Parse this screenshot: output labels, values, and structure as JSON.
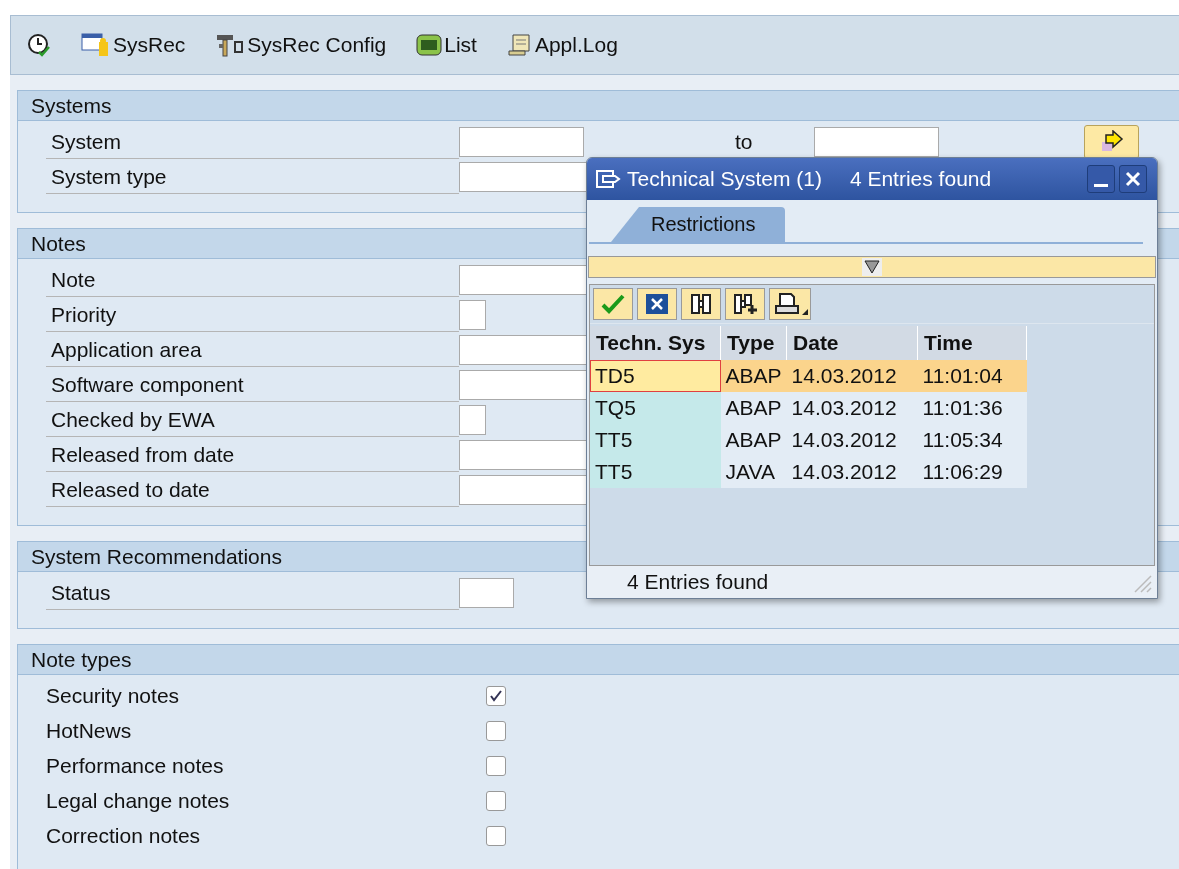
{
  "toolbar": {
    "buttons": [
      {
        "label": "SysRec"
      },
      {
        "label": "SysRec Config"
      },
      {
        "label": "List"
      },
      {
        "label": "Appl.Log"
      }
    ]
  },
  "groups": [
    {
      "title": "Systems",
      "rows": [
        {
          "label": "System",
          "kind": "range",
          "to_label": "to"
        },
        {
          "label": "System type",
          "kind": "wide"
        }
      ]
    },
    {
      "title": "Notes",
      "rows": [
        {
          "label": "Note",
          "kind": "wide"
        },
        {
          "label": "Priority",
          "kind": "tiny"
        },
        {
          "label": "Application area",
          "kind": "wide"
        },
        {
          "label": "Software component",
          "kind": "wide"
        },
        {
          "label": "Checked by EWA",
          "kind": "tiny"
        },
        {
          "label": "Released from date",
          "kind": "wide"
        },
        {
          "label": "Released to date",
          "kind": "wide"
        }
      ]
    },
    {
      "title": "System Recommendations",
      "rows": [
        {
          "label": "Status",
          "kind": "short"
        }
      ]
    }
  ],
  "note_types": {
    "title": "Note types",
    "items": [
      {
        "label": "Security notes",
        "checked": true
      },
      {
        "label": "HotNews",
        "checked": false
      },
      {
        "label": "Performance notes",
        "checked": false
      },
      {
        "label": "Legal change notes",
        "checked": false
      },
      {
        "label": "Correction notes",
        "checked": false
      }
    ]
  },
  "popup": {
    "title": "Technical System (1)",
    "subtitle": "4 Entries found",
    "tabs": [
      {
        "label": "Restrictions",
        "selected": true
      }
    ],
    "table": {
      "columns": [
        "Techn. Sys",
        "Type",
        "Date",
        "Time"
      ],
      "rows": [
        {
          "cells": [
            "TD5",
            "ABAP",
            "14.03.2012",
            "11:01:04"
          ],
          "selected": true
        },
        {
          "cells": [
            "TQ5",
            "ABAP",
            "14.03.2012",
            "11:01:36"
          ],
          "selected": false
        },
        {
          "cells": [
            "TT5",
            "ABAP",
            "14.03.2012",
            "11:05:34"
          ],
          "selected": false
        },
        {
          "cells": [
            "TT5",
            "JAVA",
            "14.03.2012",
            "11:06:29"
          ],
          "selected": false
        }
      ]
    },
    "status": "4 Entries found"
  }
}
